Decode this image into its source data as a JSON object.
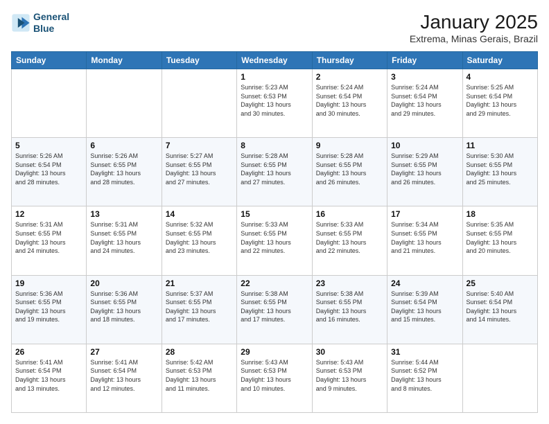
{
  "header": {
    "logo_line1": "General",
    "logo_line2": "Blue",
    "month": "January 2025",
    "location": "Extrema, Minas Gerais, Brazil"
  },
  "weekdays": [
    "Sunday",
    "Monday",
    "Tuesday",
    "Wednesday",
    "Thursday",
    "Friday",
    "Saturday"
  ],
  "weeks": [
    [
      {
        "day": "",
        "info": ""
      },
      {
        "day": "",
        "info": ""
      },
      {
        "day": "",
        "info": ""
      },
      {
        "day": "1",
        "info": "Sunrise: 5:23 AM\nSunset: 6:53 PM\nDaylight: 13 hours\nand 30 minutes."
      },
      {
        "day": "2",
        "info": "Sunrise: 5:24 AM\nSunset: 6:54 PM\nDaylight: 13 hours\nand 30 minutes."
      },
      {
        "day": "3",
        "info": "Sunrise: 5:24 AM\nSunset: 6:54 PM\nDaylight: 13 hours\nand 29 minutes."
      },
      {
        "day": "4",
        "info": "Sunrise: 5:25 AM\nSunset: 6:54 PM\nDaylight: 13 hours\nand 29 minutes."
      }
    ],
    [
      {
        "day": "5",
        "info": "Sunrise: 5:26 AM\nSunset: 6:54 PM\nDaylight: 13 hours\nand 28 minutes."
      },
      {
        "day": "6",
        "info": "Sunrise: 5:26 AM\nSunset: 6:55 PM\nDaylight: 13 hours\nand 28 minutes."
      },
      {
        "day": "7",
        "info": "Sunrise: 5:27 AM\nSunset: 6:55 PM\nDaylight: 13 hours\nand 27 minutes."
      },
      {
        "day": "8",
        "info": "Sunrise: 5:28 AM\nSunset: 6:55 PM\nDaylight: 13 hours\nand 27 minutes."
      },
      {
        "day": "9",
        "info": "Sunrise: 5:28 AM\nSunset: 6:55 PM\nDaylight: 13 hours\nand 26 minutes."
      },
      {
        "day": "10",
        "info": "Sunrise: 5:29 AM\nSunset: 6:55 PM\nDaylight: 13 hours\nand 26 minutes."
      },
      {
        "day": "11",
        "info": "Sunrise: 5:30 AM\nSunset: 6:55 PM\nDaylight: 13 hours\nand 25 minutes."
      }
    ],
    [
      {
        "day": "12",
        "info": "Sunrise: 5:31 AM\nSunset: 6:55 PM\nDaylight: 13 hours\nand 24 minutes."
      },
      {
        "day": "13",
        "info": "Sunrise: 5:31 AM\nSunset: 6:55 PM\nDaylight: 13 hours\nand 24 minutes."
      },
      {
        "day": "14",
        "info": "Sunrise: 5:32 AM\nSunset: 6:55 PM\nDaylight: 13 hours\nand 23 minutes."
      },
      {
        "day": "15",
        "info": "Sunrise: 5:33 AM\nSunset: 6:55 PM\nDaylight: 13 hours\nand 22 minutes."
      },
      {
        "day": "16",
        "info": "Sunrise: 5:33 AM\nSunset: 6:55 PM\nDaylight: 13 hours\nand 22 minutes."
      },
      {
        "day": "17",
        "info": "Sunrise: 5:34 AM\nSunset: 6:55 PM\nDaylight: 13 hours\nand 21 minutes."
      },
      {
        "day": "18",
        "info": "Sunrise: 5:35 AM\nSunset: 6:55 PM\nDaylight: 13 hours\nand 20 minutes."
      }
    ],
    [
      {
        "day": "19",
        "info": "Sunrise: 5:36 AM\nSunset: 6:55 PM\nDaylight: 13 hours\nand 19 minutes."
      },
      {
        "day": "20",
        "info": "Sunrise: 5:36 AM\nSunset: 6:55 PM\nDaylight: 13 hours\nand 18 minutes."
      },
      {
        "day": "21",
        "info": "Sunrise: 5:37 AM\nSunset: 6:55 PM\nDaylight: 13 hours\nand 17 minutes."
      },
      {
        "day": "22",
        "info": "Sunrise: 5:38 AM\nSunset: 6:55 PM\nDaylight: 13 hours\nand 17 minutes."
      },
      {
        "day": "23",
        "info": "Sunrise: 5:38 AM\nSunset: 6:55 PM\nDaylight: 13 hours\nand 16 minutes."
      },
      {
        "day": "24",
        "info": "Sunrise: 5:39 AM\nSunset: 6:54 PM\nDaylight: 13 hours\nand 15 minutes."
      },
      {
        "day": "25",
        "info": "Sunrise: 5:40 AM\nSunset: 6:54 PM\nDaylight: 13 hours\nand 14 minutes."
      }
    ],
    [
      {
        "day": "26",
        "info": "Sunrise: 5:41 AM\nSunset: 6:54 PM\nDaylight: 13 hours\nand 13 minutes."
      },
      {
        "day": "27",
        "info": "Sunrise: 5:41 AM\nSunset: 6:54 PM\nDaylight: 13 hours\nand 12 minutes."
      },
      {
        "day": "28",
        "info": "Sunrise: 5:42 AM\nSunset: 6:53 PM\nDaylight: 13 hours\nand 11 minutes."
      },
      {
        "day": "29",
        "info": "Sunrise: 5:43 AM\nSunset: 6:53 PM\nDaylight: 13 hours\nand 10 minutes."
      },
      {
        "day": "30",
        "info": "Sunrise: 5:43 AM\nSunset: 6:53 PM\nDaylight: 13 hours\nand 9 minutes."
      },
      {
        "day": "31",
        "info": "Sunrise: 5:44 AM\nSunset: 6:52 PM\nDaylight: 13 hours\nand 8 minutes."
      },
      {
        "day": "",
        "info": ""
      }
    ]
  ]
}
